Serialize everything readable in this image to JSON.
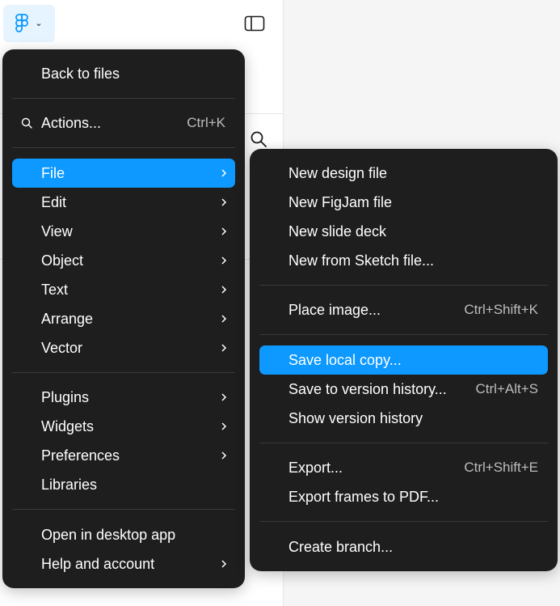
{
  "main_menu": {
    "back": "Back to files",
    "actions": {
      "label": "Actions...",
      "shortcut": "Ctrl+K"
    },
    "items": [
      {
        "label": "File"
      },
      {
        "label": "Edit"
      },
      {
        "label": "View"
      },
      {
        "label": "Object"
      },
      {
        "label": "Text"
      },
      {
        "label": "Arrange"
      },
      {
        "label": "Vector"
      },
      {
        "label": "Plugins"
      },
      {
        "label": "Widgets"
      },
      {
        "label": "Preferences"
      },
      {
        "label": "Libraries"
      },
      {
        "label": "Open in desktop app"
      },
      {
        "label": "Help and account"
      }
    ]
  },
  "file_submenu": {
    "items": [
      {
        "label": "New design file"
      },
      {
        "label": "New FigJam file"
      },
      {
        "label": "New slide deck"
      },
      {
        "label": "New from Sketch file..."
      },
      {
        "label": "Place image...",
        "shortcut": "Ctrl+Shift+K"
      },
      {
        "label": "Save local copy..."
      },
      {
        "label": "Save to version history...",
        "shortcut": "Ctrl+Alt+S"
      },
      {
        "label": "Show version history"
      },
      {
        "label": "Export...",
        "shortcut": "Ctrl+Shift+E"
      },
      {
        "label": "Export frames to PDF..."
      },
      {
        "label": "Create branch..."
      }
    ]
  },
  "colors": {
    "menu_bg": "#1e1e1e",
    "highlight": "#0d99ff",
    "figma_button_bg": "#e5f4ff"
  },
  "icons": [
    "figma-logo-icon",
    "chevron-down-icon",
    "sidebar-toggle-icon",
    "search-icon",
    "chevron-right-icon"
  ]
}
